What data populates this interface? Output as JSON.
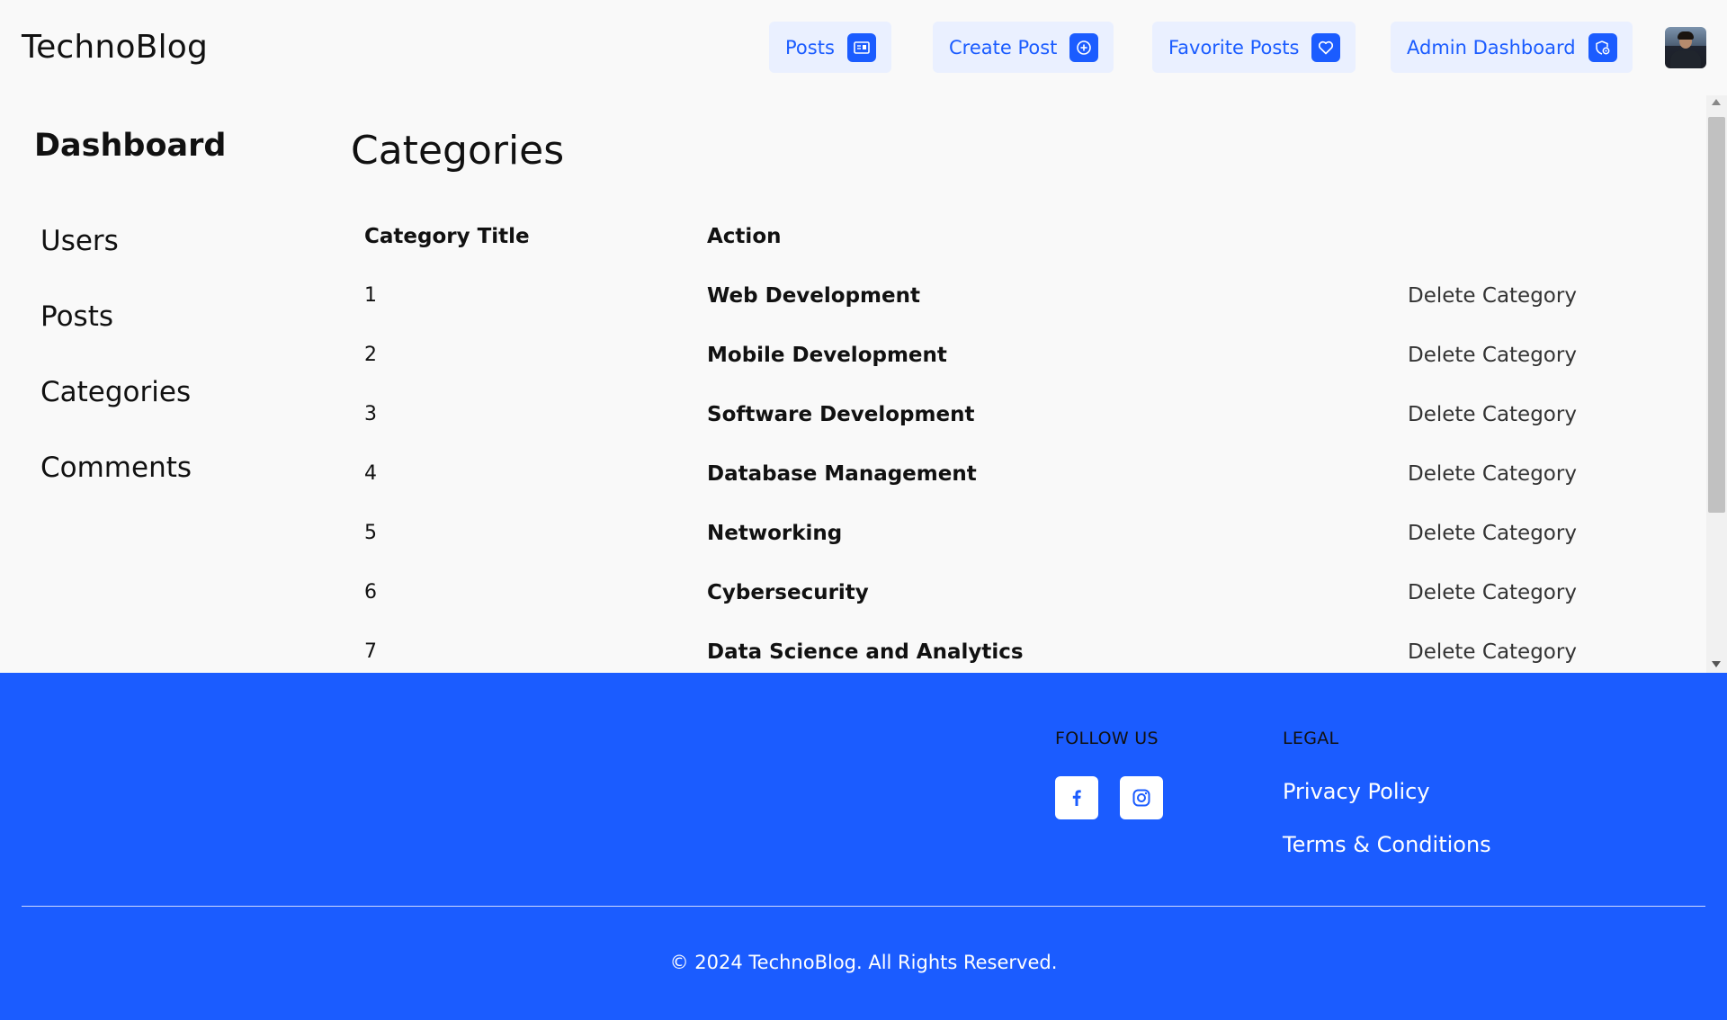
{
  "header": {
    "brand": "TechnoBlog",
    "nav": [
      {
        "label": "Posts",
        "icon": "newspaper-icon"
      },
      {
        "label": "Create Post",
        "icon": "plus-circle-icon"
      },
      {
        "label": "Favorite Posts",
        "icon": "heart-icon"
      },
      {
        "label": "Admin Dashboard",
        "icon": "admin-shield-icon"
      }
    ],
    "avatar": "user-avatar"
  },
  "sidebar": {
    "title": "Dashboard",
    "items": [
      {
        "label": "Users"
      },
      {
        "label": "Posts"
      },
      {
        "label": "Categories"
      },
      {
        "label": "Comments"
      }
    ]
  },
  "main": {
    "title": "Categories",
    "columns": [
      "Category Title",
      "Action"
    ],
    "rows": [
      {
        "id": "1",
        "title": "Web Development",
        "action": "Delete Category"
      },
      {
        "id": "2",
        "title": "Mobile Development",
        "action": "Delete Category"
      },
      {
        "id": "3",
        "title": "Software Development",
        "action": "Delete Category"
      },
      {
        "id": "4",
        "title": "Database Management",
        "action": "Delete Category"
      },
      {
        "id": "5",
        "title": "Networking",
        "action": "Delete Category"
      },
      {
        "id": "6",
        "title": "Cybersecurity",
        "action": "Delete Category"
      },
      {
        "id": "7",
        "title": "Data Science and Analytics",
        "action": "Delete Category"
      }
    ]
  },
  "footer": {
    "follow_heading": "FOLLOW US",
    "social": [
      {
        "icon": "facebook-icon"
      },
      {
        "icon": "instagram-icon"
      }
    ],
    "legal_heading": "LEGAL",
    "links": [
      {
        "label": "Privacy Policy"
      },
      {
        "label": "Terms & Conditions"
      }
    ],
    "copyright": "© 2024 TechnoBlog. All Rights Reserved."
  },
  "colors": {
    "accent": "#1b5cff",
    "nav_bg": "#eaf0ff",
    "page_bg": "#f9f9f9"
  }
}
